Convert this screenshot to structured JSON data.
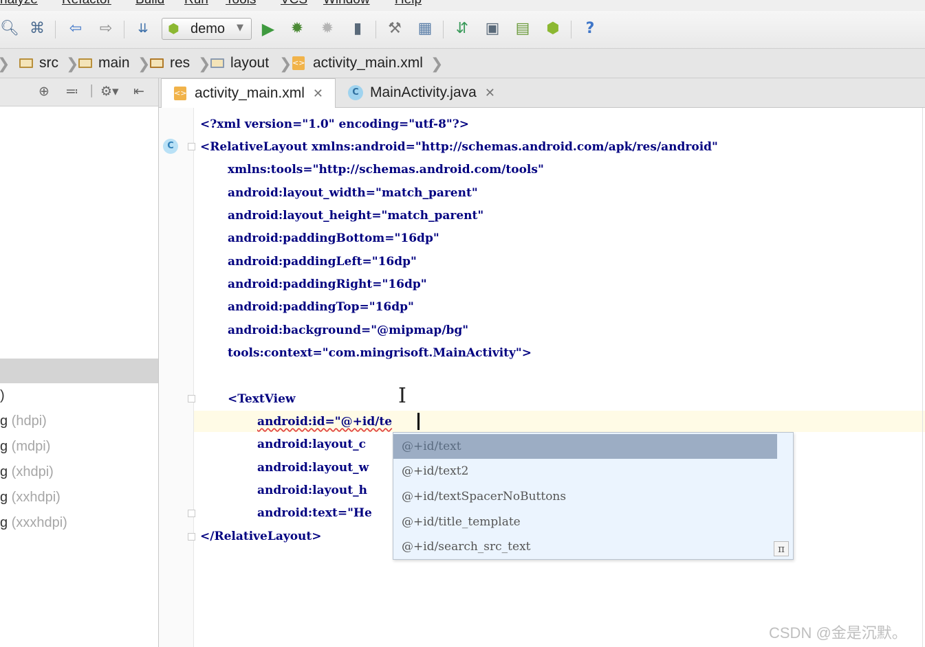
{
  "menu": [
    "nalyze",
    "Refactor",
    "Build",
    "Run",
    "Tools",
    "VCS",
    "Window",
    "Help"
  ],
  "toolbar": {
    "run_config": "demo",
    "icons": [
      "search-icon",
      "search-replace-icon",
      "back-icon",
      "forward-icon",
      "make-project-icon",
      "run-config-icon",
      "run-icon",
      "debug-icon",
      "attach-debugger-icon",
      "apply-changes-icon",
      "project-structure-icon",
      "sdk-manager-icon",
      "sync-gradle-icon",
      "avd-manager-icon",
      "device-monitor-icon",
      "android-icon",
      "help-icon"
    ],
    "help_label": "?"
  },
  "breadcrumb": [
    "src",
    "main",
    "res",
    "layout",
    "activity_main.xml"
  ],
  "left_panel": {
    "tree_items": [
      {
        "prefix": "",
        "label": ")"
      },
      {
        "prefix": "g",
        "label": " (hdpi)"
      },
      {
        "prefix": "g",
        "label": " (mdpi)"
      },
      {
        "prefix": "g",
        "label": " (xhdpi)"
      },
      {
        "prefix": "g",
        "label": " (xxhdpi)"
      },
      {
        "prefix": "g",
        "label": " (xxxhdpi)"
      }
    ]
  },
  "tabs": [
    {
      "label": "activity_main.xml",
      "active": true
    },
    {
      "label": "MainActivity.java",
      "active": false
    }
  ],
  "editor": {
    "gutter_marker": "C",
    "lines": [
      "<?xml version=\"1.0\" encoding=\"utf-8\"?>",
      "<RelativeLayout xmlns:android=\"http://schemas.android.com/apk/res/android\"",
      "xmlns:tools=\"http://schemas.android.com/tools\"",
      "android:layout_width=\"match_parent\"",
      "android:layout_height=\"match_parent\"",
      "android:paddingBottom=\"16dp\"",
      "android:paddingLeft=\"16dp\"",
      "android:paddingRight=\"16dp\"",
      "android:paddingTop=\"16dp\"",
      "android:background=\"@mipmap/bg\"",
      "tools:context=\"com.mingrisoft.MainActivity\">",
      "",
      "<TextView",
      "android:id=\"@+id/te",
      "android:layout_c",
      "android:layout_w",
      "android:layout_h",
      "android:text=\"He",
      "</RelativeLayout>"
    ]
  },
  "completion": {
    "items": [
      "@+id/text",
      "@+id/text2",
      "@+id/textSpacerNoButtons",
      "@+id/title_template",
      "@+id/search_src_text"
    ],
    "selected_index": 0,
    "pi_label": "π"
  },
  "watermark": "CSDN @金是沉默。"
}
